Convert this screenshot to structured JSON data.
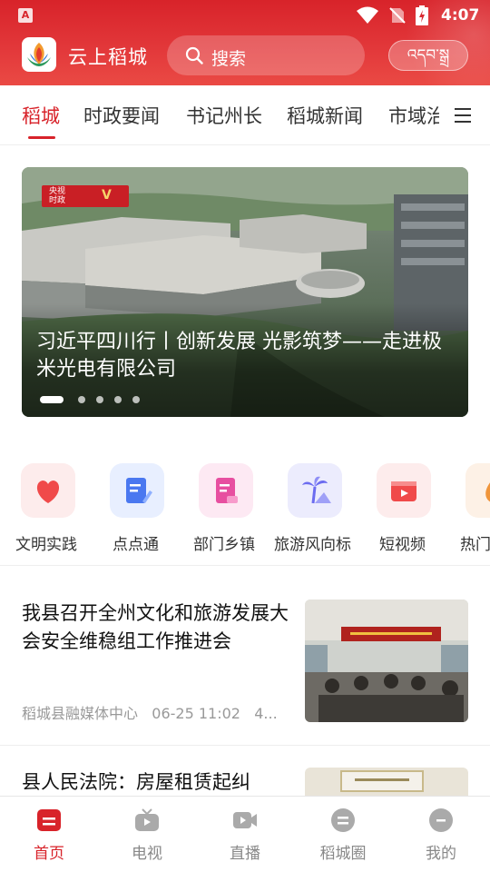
{
  "status_bar": {
    "time": "4:07"
  },
  "header": {
    "app_title": "云上稻城",
    "search_placeholder": "搜索",
    "tibetan_button": "འདབ་སྒྲ"
  },
  "tabs": [
    {
      "label": "稻城"
    },
    {
      "label": "时政要闻"
    },
    {
      "label": "书记州长"
    },
    {
      "label": "稻城新闻"
    },
    {
      "label": "市域治"
    }
  ],
  "banner": {
    "title": "习近平四川行丨创新发展 光影筑梦——走进极米光电有限公司",
    "badge_top": "央视",
    "badge_bottom": "时政",
    "badge_mark": "V"
  },
  "quick_links": [
    {
      "label": "文明实践",
      "icon": "heart-icon",
      "bg": "#fdecec",
      "color": "#f04a4a"
    },
    {
      "label": "点点通",
      "icon": "notepad-icon",
      "bg": "#e8efff",
      "color": "#4a78f0"
    },
    {
      "label": "部门乡镇",
      "icon": "document-icon",
      "bg": "#fde9f3",
      "color": "#e74fa0"
    },
    {
      "label": "旅游风向标",
      "icon": "palm-tree-icon",
      "bg": "#ececfd",
      "color": "#6c6cf0"
    },
    {
      "label": "短视频",
      "icon": "video-icon",
      "bg": "#fdecec",
      "color": "#f04a4a"
    },
    {
      "label": "热门",
      "icon": "fire-icon",
      "bg": "#fdf1e6",
      "color": "#f0953a"
    }
  ],
  "news": [
    {
      "title": "我县召开全州文化和旅游发展大会安全维稳组工作推进会",
      "source": "稻城县融媒体中心",
      "time": "06-25 11:02",
      "extra": "4..."
    },
    {
      "title": "县人民法院：房屋租赁起纠"
    }
  ],
  "bottom_nav": [
    {
      "label": "首页",
      "icon": "home-icon",
      "active": true
    },
    {
      "label": "电视",
      "icon": "tv-icon",
      "active": false
    },
    {
      "label": "直播",
      "icon": "live-camera-icon",
      "active": false
    },
    {
      "label": "稻城圈",
      "icon": "circle-chat-icon",
      "active": false
    },
    {
      "label": "我的",
      "icon": "profile-icon",
      "active": false
    }
  ],
  "colors": {
    "brand_red": "#d8232a"
  }
}
